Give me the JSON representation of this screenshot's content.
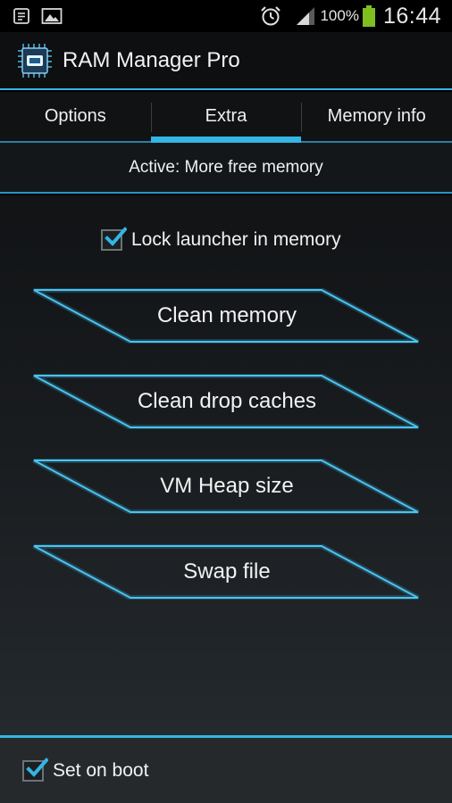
{
  "status_bar": {
    "icons_left": [
      "notes-icon",
      "image-icon"
    ],
    "icons_right": [
      "alarm-icon",
      "signal-icon",
      "battery-icon"
    ],
    "battery": "100%",
    "time": "16:44"
  },
  "app": {
    "title": "RAM Manager Pro",
    "logo_icon": "chip-icon"
  },
  "tabs": [
    {
      "label": "Options",
      "active": false
    },
    {
      "label": "Extra",
      "active": true
    },
    {
      "label": "Memory info",
      "active": false
    }
  ],
  "active_profile": "Active: More free memory",
  "lock_launcher": {
    "label": "Lock launcher in memory",
    "checked": true
  },
  "buttons": [
    {
      "label": "Clean memory"
    },
    {
      "label": "Clean drop caches"
    },
    {
      "label": "VM Heap size"
    },
    {
      "label": "Swap file"
    }
  ],
  "set_on_boot": {
    "label": "Set on boot",
    "checked": true
  },
  "colors": {
    "accent": "#33b5e5",
    "background": "#1a1d20",
    "text": "#f2f2f2"
  }
}
